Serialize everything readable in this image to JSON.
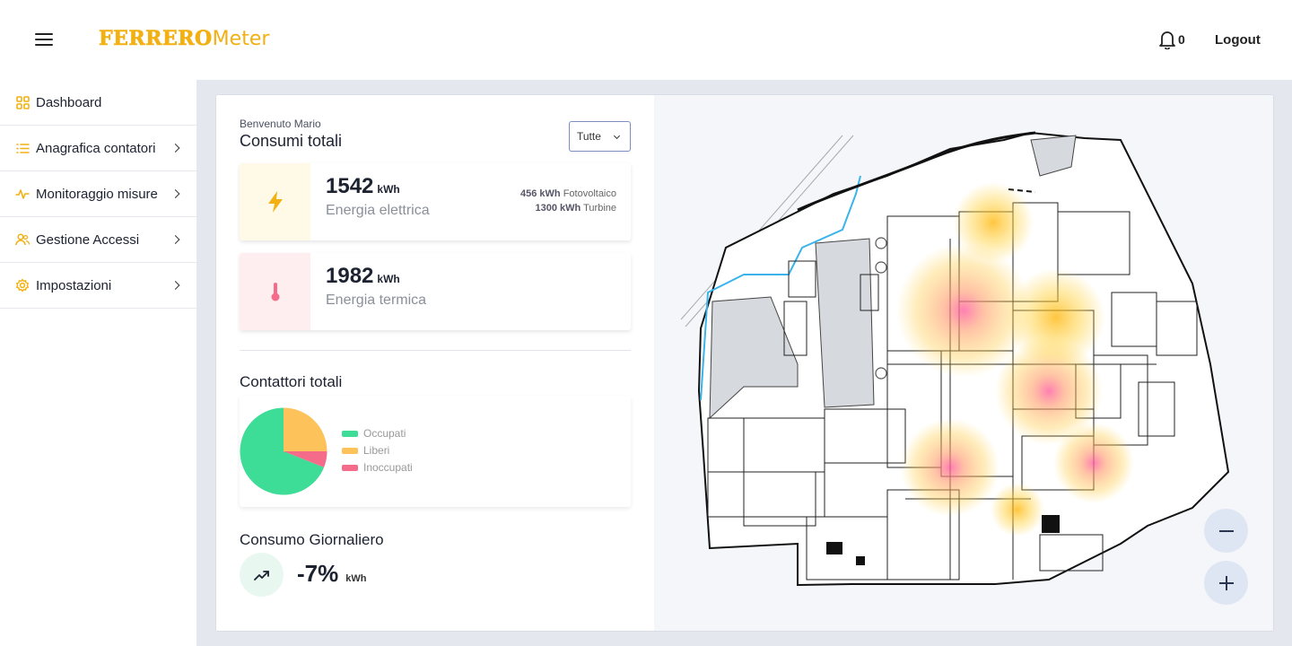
{
  "header": {
    "logo_brand": "FERRERO",
    "logo_product": "Meter",
    "notification_count": "0",
    "logout_label": "Logout"
  },
  "sidebar": {
    "items": [
      {
        "label": "Dashboard",
        "icon": "grid-icon",
        "has_chevron": false
      },
      {
        "label": "Anagrafica contatori",
        "icon": "list-icon",
        "has_chevron": true
      },
      {
        "label": "Monitoraggio misure",
        "icon": "activity-icon",
        "has_chevron": true
      },
      {
        "label": "Gestione Accessi",
        "icon": "users-icon",
        "has_chevron": true
      },
      {
        "label": "Impostazioni",
        "icon": "gear-icon",
        "has_chevron": true
      }
    ]
  },
  "main": {
    "welcome": "Benvenuto Mario",
    "title": "Consumi totali",
    "filter": {
      "selected": "Tutte"
    },
    "electric": {
      "value": "1542",
      "unit": "kWh",
      "label": "Energia elettrica",
      "detail": [
        {
          "value": "456 kWh",
          "label": "Fotovoltaico"
        },
        {
          "value": "1300 kWh",
          "label": "Turbine"
        }
      ]
    },
    "thermal": {
      "value": "1982",
      "unit": "kWh",
      "label": "Energia termica"
    },
    "meters": {
      "title": "Contattori totali",
      "legend": [
        "Occupati",
        "Liberi",
        "Inoccupati"
      ]
    },
    "daily": {
      "title": "Consumo Giornaliero",
      "value": "-7%",
      "unit": "kWh"
    }
  },
  "chart_data": {
    "type": "pie",
    "categories": [
      "Occupati",
      "Liberi",
      "Inoccupati"
    ],
    "values": [
      69,
      25,
      6
    ],
    "colors": [
      "#3ddc97",
      "#fdc35a",
      "#f46c8a"
    ]
  },
  "colors": {
    "brand": "#f2b012",
    "electric_bg": "#fff9e8",
    "electric_icon": "#f2b012",
    "thermal_bg": "#ffeef0",
    "thermal_icon": "#f46c8a",
    "accent": "#f2b012"
  }
}
